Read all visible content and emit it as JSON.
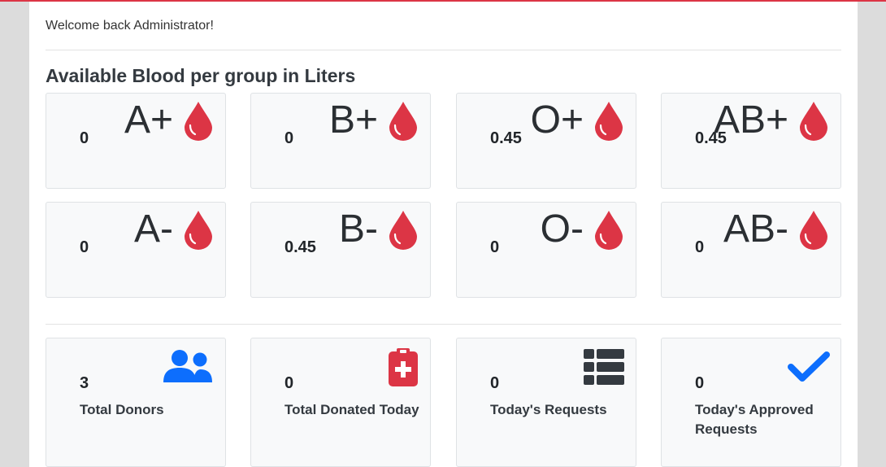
{
  "welcome_text": "Welcome back Administrator!",
  "section_title": "Available Blood per group in Liters",
  "blood_groups": [
    {
      "group": "A+",
      "value": "0"
    },
    {
      "group": "B+",
      "value": "0"
    },
    {
      "group": "O+",
      "value": "0.45"
    },
    {
      "group": "AB+",
      "value": "0.45"
    },
    {
      "group": "A-",
      "value": "0"
    },
    {
      "group": "B-",
      "value": "0.45"
    },
    {
      "group": "O-",
      "value": "0"
    },
    {
      "group": "AB-",
      "value": "0"
    }
  ],
  "stats": [
    {
      "value": "3",
      "label": "Total Donors",
      "icon": "users-icon",
      "color": "#0d6efd"
    },
    {
      "value": "0",
      "label": "Total Donated Today",
      "icon": "clipboard-medical-icon",
      "color": "#dc3545"
    },
    {
      "value": "0",
      "label": "Today's Requests",
      "icon": "list-icon",
      "color": "#343a40"
    },
    {
      "value": "0",
      "label": "Today's Approved Requests",
      "icon": "check-icon",
      "color": "#0d6efd"
    }
  ],
  "colors": {
    "accent": "#dc3545",
    "drop": "#dc3545"
  }
}
